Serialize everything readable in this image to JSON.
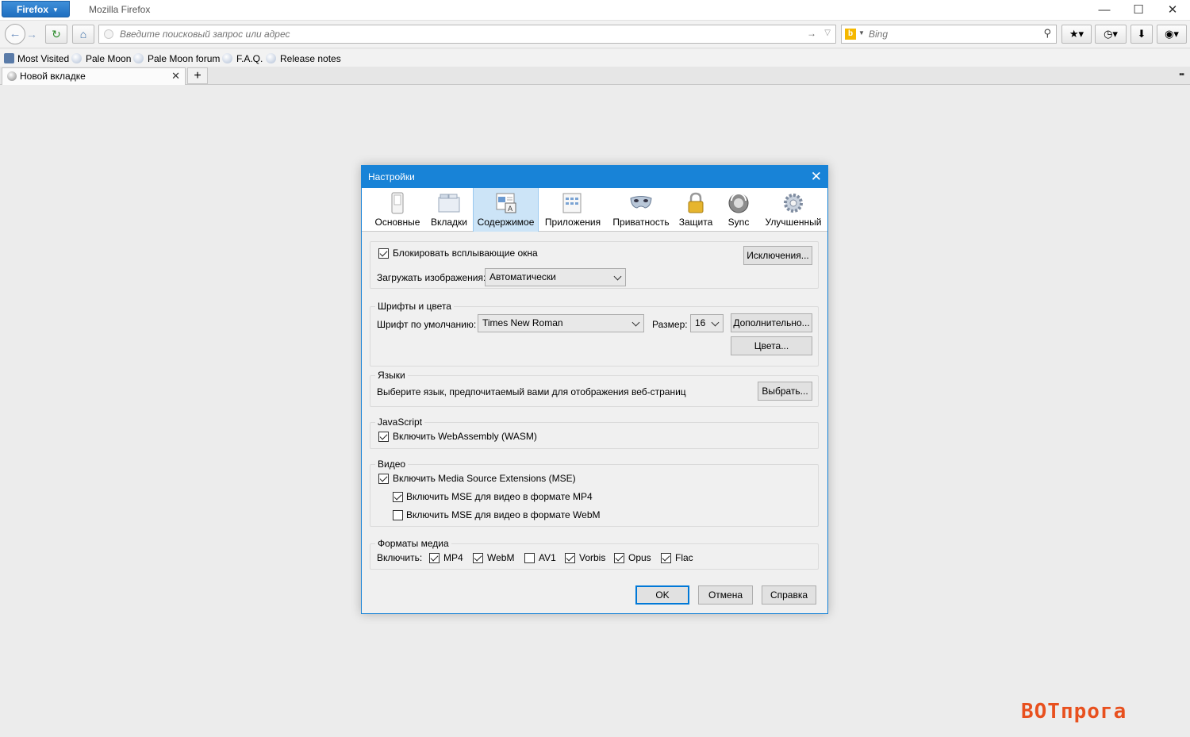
{
  "window": {
    "menu_button": "Firefox",
    "title": "Mozilla Firefox"
  },
  "navbar": {
    "url_placeholder": "Введите поисковый запрос или адрес",
    "search_engine": "Bing"
  },
  "bookmarks": [
    {
      "label": "Most Visited"
    },
    {
      "label": "Pale Moon"
    },
    {
      "label": "Pale Moon forum"
    },
    {
      "label": "F.A.Q."
    },
    {
      "label": "Release notes"
    }
  ],
  "tab": {
    "title": "Новой вкладке"
  },
  "dialog": {
    "title": "Настройки",
    "panes": [
      {
        "label": "Основные"
      },
      {
        "label": "Вкладки"
      },
      {
        "label": "Содержимое"
      },
      {
        "label": "Приложения"
      },
      {
        "label": "Приватность"
      },
      {
        "label": "Защита"
      },
      {
        "label": "Sync"
      },
      {
        "label": "Улучшенный"
      }
    ],
    "selected_pane": "Содержимое",
    "popups": {
      "block_label": "Блокировать всплывающие окна",
      "block_checked": true,
      "exceptions_button": "Исключения...",
      "load_images_label": "Загружать изображения:",
      "load_images_value": "Автоматически"
    },
    "fonts": {
      "caption": "Шрифты и цвета",
      "default_font_label": "Шрифт по умолчанию:",
      "default_font_value": "Times New Roman",
      "size_label": "Размер:",
      "size_value": "16",
      "advanced_button": "Дополнительно...",
      "colors_button": "Цвета..."
    },
    "languages": {
      "caption": "Языки",
      "description": "Выберите язык, предпочитаемый вами для отображения веб-страниц",
      "choose_button": "Выбрать..."
    },
    "javascript": {
      "caption": "JavaScript",
      "wasm_label": "Включить WebAssembly (WASM)",
      "wasm_checked": true
    },
    "video": {
      "caption": "Видео",
      "mse_label": "Включить Media Source Extensions (MSE)",
      "mse_checked": true,
      "mp4_label": "Включить MSE для видео в формате MP4",
      "mp4_checked": true,
      "webm_label": "Включить MSE для видео в формате WebM",
      "webm_checked": false
    },
    "media": {
      "caption": "Форматы медиа",
      "enable_label": "Включить:",
      "formats": [
        {
          "label": "MP4",
          "checked": true
        },
        {
          "label": "WebM",
          "checked": true
        },
        {
          "label": "AV1",
          "checked": false
        },
        {
          "label": "Vorbis",
          "checked": true
        },
        {
          "label": "Opus",
          "checked": true
        },
        {
          "label": "Flac",
          "checked": true
        }
      ]
    },
    "buttons": {
      "ok": "OK",
      "cancel": "Отмена",
      "help": "Справка"
    }
  },
  "watermark": {
    "text": "BOTпрога",
    "color": "#e8501e"
  },
  "colors": {
    "dialog_accent": "#1883d7",
    "selected_pane": "#cce4f7"
  }
}
